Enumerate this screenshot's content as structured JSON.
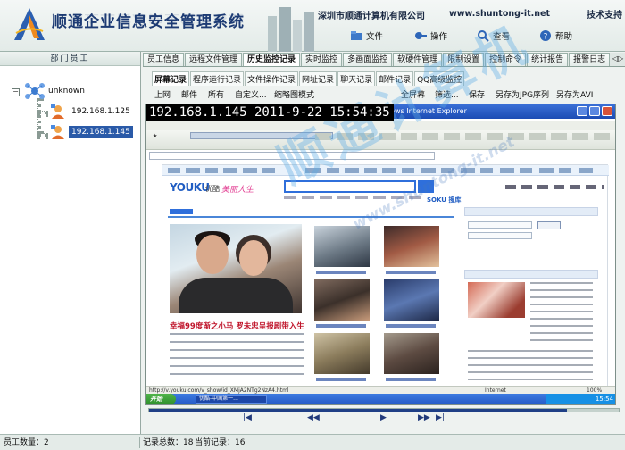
{
  "app": {
    "title": "顺通企业信息安全管理系统",
    "company": "深圳市顺通计算机有限公司",
    "website": "www.shuntong-it.net",
    "support": "技术支持"
  },
  "menu": [
    {
      "label": "文件",
      "icon": "folder-icon"
    },
    {
      "label": "操作",
      "icon": "operation-icon"
    },
    {
      "label": "查看",
      "icon": "view-icon"
    },
    {
      "label": "帮助",
      "icon": "help-icon"
    }
  ],
  "left_panel": {
    "header": "部门员工",
    "root": "unknown",
    "employees": [
      "192.168.1.125",
      "192.168.1.145"
    ],
    "selected": "192.168.1.145"
  },
  "tabs": [
    "员工信息",
    "远程文件管理",
    "历史监控记录",
    "实时监控",
    "多画面监控",
    "软硬件管理",
    "限制设置",
    "控制命令",
    "统计报告",
    "报警日志"
  ],
  "active_tab": "历史监控记录",
  "subtabs": [
    "屏幕记录",
    "程序运行记录",
    "文件操作记录",
    "网址记录",
    "聊天记录",
    "邮件记录",
    "QQ高级监控"
  ],
  "active_subtab": "屏幕记录",
  "toolbar": {
    "prev": "上网",
    "mail": "邮件",
    "all": "所有",
    "custom": "自定义...",
    "thumb": "缩略图模式",
    "fullscreen": "全屏幕",
    "filter": "筛选...",
    "save": "保存",
    "save_jpg": "另存为JPG序列",
    "save_avi": "另存为AVI"
  },
  "screenshot": {
    "caption": "192.168.1.145  2011-9-22 15:54:35",
    "browser_title": "Windows Internet Explorer",
    "status_url": "http://v.youku.com/v_show/id_XMjA2NTg2NzA4.html",
    "taskbar_start": "开始",
    "taskbar_item": "优酷-中国第一...",
    "tray_time": "15:54",
    "zoom": "100%",
    "zone": "Internet",
    "site_logo": "YOUKU",
    "site_logo_cn": "优酷",
    "site_slogan": "美丽人生",
    "headline": "幸福99度渐之小马 罗未忠呈报剧带入生",
    "soku": "SOKU",
    "soku_cn": "搜库"
  },
  "watermark": {
    "text": "顺通计算机",
    "url": "www.shuntong-it.net"
  },
  "nav_buttons": [
    "|◀",
    "◀◀",
    "▶",
    "▶▶",
    "▶|"
  ],
  "playback_progress": 0.89,
  "statusbar": {
    "employee_count": "员工数量：2",
    "total_records": "记录总数：18",
    "current_record": "当前记录：16"
  },
  "colors": {
    "title_blue": "#1d3b74",
    "selected_node": "#2a5aa8",
    "watermark": "#5caae4"
  }
}
